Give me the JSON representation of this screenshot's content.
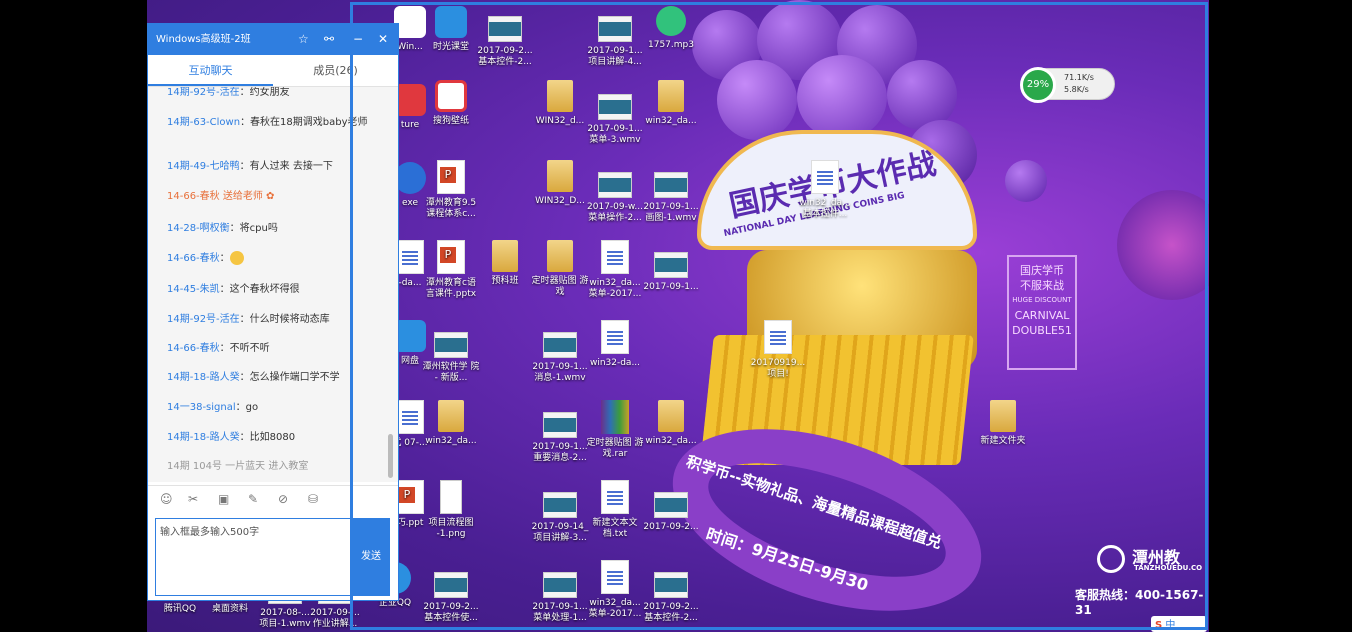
{
  "chat_window": {
    "title": "Windows高级班-2班",
    "tabs": [
      {
        "label": "互动聊天",
        "active": true
      },
      {
        "label": "成员(26)",
        "active": false
      }
    ],
    "messages": [
      {
        "name": "14期-92号-活在",
        "text": "：约女朋友",
        "color": "#2f7ee0"
      },
      {
        "name": "14期-63-Clown",
        "text": "：春秋在18期调戏baby老师",
        "color": "#2f7ee0"
      },
      {
        "name": "14期-49-七哈鸭",
        "text": "：有人过来 去接一下",
        "color": "#2f7ee0"
      },
      {
        "name": "14-66-春秋",
        "text": " 送给老师",
        "color": "#e8703a"
      },
      {
        "name": "14-28-啊权衡",
        "text": "：将cpu吗",
        "color": "#2f7ee0"
      },
      {
        "name": "14-66-春秋",
        "text": "：",
        "color": "#2f7ee0"
      },
      {
        "name": "14-45-朱凯",
        "text": "：这个春秋坏得很",
        "color": "#2f7ee0"
      },
      {
        "name": "14期-92号-活在",
        "text": "：什么时候将动态库",
        "color": "#2f7ee0"
      },
      {
        "name": "14-66-春秋",
        "text": "：不听不听",
        "color": "#2f7ee0"
      },
      {
        "name": "14期-18-路人癸",
        "text": "：怎么操作端口学不学",
        "color": "#2f7ee0"
      },
      {
        "name": "14一38-signal",
        "text": "：go",
        "color": "#2f7ee0"
      },
      {
        "name": "14期-18-路人癸",
        "text": "：比如8080",
        "color": "#2f7ee0"
      },
      {
        "name": "14期 104号 一片蓝天",
        "text": " 进入教室",
        "color": "#999999"
      }
    ],
    "input_placeholder": "输入框最多输入500字",
    "send_label": "发送"
  },
  "desktop_icons": [
    {
      "label": "Win...",
      "type": "app"
    },
    {
      "label": "时光课堂",
      "type": "app"
    },
    {
      "label": "2017-09-2... 基本控件-2...",
      "type": "video"
    },
    {
      "label": "2017-09-1... 项目讲解-4...",
      "type": "video"
    },
    {
      "label": "1757.mp3",
      "type": "music"
    },
    {
      "label": "ture",
      "type": "app"
    },
    {
      "label": "搜狗壁纸",
      "type": "app"
    },
    {
      "label": "WIN32_d...",
      "type": "folder"
    },
    {
      "label": "2017-09-1... 菜单-3.wmv",
      "type": "video"
    },
    {
      "label": "win32_da...",
      "type": "folder"
    },
    {
      "label": "exe",
      "type": "app"
    },
    {
      "label": "潭州教育9.5 课程体系c...",
      "type": "ppt"
    },
    {
      "label": "WIN32_D...",
      "type": "folder"
    },
    {
      "label": "2017-09-w... 菜单操作-2...",
      "type": "video"
    },
    {
      "label": "2017-09-1... 画图-1.wmv",
      "type": "video"
    },
    {
      "label": "win32_da... 基本控件...",
      "type": "doc"
    },
    {
      "label": "-da...",
      "type": "doc"
    },
    {
      "label": "潭州教育c语 言课件.pptx",
      "type": "ppt"
    },
    {
      "label": "预科班",
      "type": "folder"
    },
    {
      "label": "定时器贴图 游戏",
      "type": "folder"
    },
    {
      "label": "win32_da... 菜单-2017...",
      "type": "doc"
    },
    {
      "label": "2017-09-1...",
      "type": "video"
    },
    {
      "label": "网盘",
      "type": "app"
    },
    {
      "label": "潭州软件学 院 - 新版...",
      "type": "video"
    },
    {
      "label": "2017-09-1... 消息-1.wmv",
      "type": "video"
    },
    {
      "label": "win32-da...",
      "type": "doc"
    },
    {
      "label": "20170919... 项目!",
      "type": "doc"
    },
    {
      "label": "式 07-...",
      "type": "doc"
    },
    {
      "label": "win32_da...",
      "type": "folder"
    },
    {
      "label": "2017-09-1... 重要消息-2...",
      "type": "video"
    },
    {
      "label": "定时器贴图 游戏.rar",
      "type": "rar"
    },
    {
      "label": "win32_da...",
      "type": "folder"
    },
    {
      "label": "新建文件夹",
      "type": "folder"
    },
    {
      "label": "巧.ppt",
      "type": "ppt"
    },
    {
      "label": "项目流程图 -1.png",
      "type": "png"
    },
    {
      "label": "2017-09-14_ 项目讲解-3...",
      "type": "video"
    },
    {
      "label": "新建文本文 档.txt",
      "type": "doc"
    },
    {
      "label": "2017-09-2...",
      "type": "video"
    },
    {
      "label": "腾讯QQ",
      "type": "app"
    },
    {
      "label": "桌面资料",
      "type": "folder"
    },
    {
      "label": "2017-08-... 项目-1.wmv",
      "type": "video"
    },
    {
      "label": "2017-09-... 作业讲解...",
      "type": "video"
    },
    {
      "label": "企业QQ",
      "type": "app"
    },
    {
      "label": "2017-09-2... 基本控件使...",
      "type": "video"
    },
    {
      "label": "2017-09-1... 菜单处理-1...",
      "type": "video"
    },
    {
      "label": "win32_da... 菜单-2017...",
      "type": "doc"
    },
    {
      "label": "2017-09-2... 基本控件-2...",
      "type": "video"
    }
  ],
  "poster": {
    "title": "国庆学币大作战",
    "subtitle": "NATIONAL DAY LEARNING COINS BIG",
    "banner": "积学币--实物礼品、海量精品课程超值兑",
    "date": "时间：9月25日-9月30",
    "side_box": [
      "国庆学币",
      "不服来战",
      "HUGE DISCOUNT",
      "CARNIVAL",
      "DOUBLE51"
    ],
    "brand": "潭州教",
    "brand_en": "TANZHOUEDU.CO",
    "hotline": "客服热线：400-1567-31"
  },
  "net_widget": {
    "percent": "29%",
    "up": "71.1K/s",
    "down": "5.8K/s"
  },
  "colors": {
    "accent": "#2f7ee0",
    "desktop": "#6a2cb8",
    "gold": "#f2c230"
  }
}
